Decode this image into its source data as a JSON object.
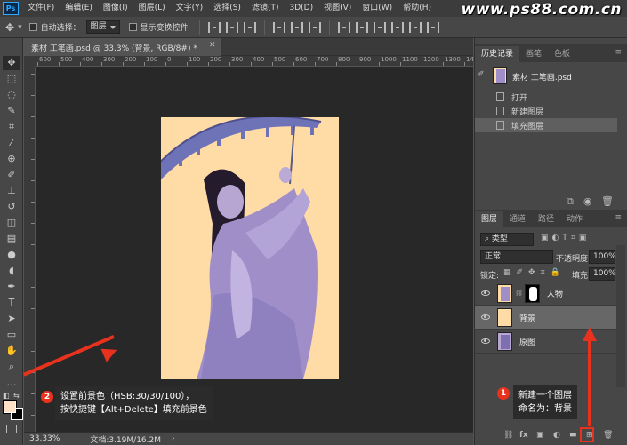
{
  "menubar": {
    "logo": "Ps",
    "items": [
      "文件(F)",
      "编辑(E)",
      "图像(I)",
      "图层(L)",
      "文字(Y)",
      "选择(S)",
      "滤镜(T)",
      "3D(D)",
      "视图(V)",
      "窗口(W)",
      "帮助(H)"
    ],
    "watermark": "www.ps88.com.cn"
  },
  "options": {
    "auto_select_label": "自动选择：",
    "auto_select_value": "图层",
    "show_transform_label": "显示变换控件"
  },
  "document": {
    "tab_title": "素材 工笔画.psd @ 33.3% (背景, RGB/8#) *",
    "ruler_ticks": [
      "600",
      "500",
      "400",
      "300",
      "200",
      "100",
      "0",
      "100",
      "200",
      "300",
      "400",
      "500",
      "600",
      "700",
      "800",
      "900",
      "1000",
      "1100",
      "1200",
      "1300",
      "1400"
    ],
    "zoom": "33.33%",
    "doc_size": "文档:3.19M/16.2M"
  },
  "history": {
    "tabs": [
      "历史记录",
      "画笔",
      "色板"
    ],
    "snapshot": "素材 工笔画.psd",
    "items": [
      "打开",
      "新建图层",
      "填充图层"
    ]
  },
  "layers": {
    "tabs": [
      "图层",
      "通道",
      "路径",
      "动作"
    ],
    "filter": "类型",
    "blend_mode": "正常",
    "opacity_label": "不透明度:",
    "opacity": "100%",
    "lock_label": "锁定:",
    "fill_label": "填充:",
    "fill": "100%",
    "rows": [
      "人物",
      "背景",
      "原图"
    ],
    "footer_icons": [
      "link-icon",
      "fx-icon",
      "mask-icon",
      "adjustment-icon",
      "folder-icon",
      "new-layer-icon",
      "trash-icon"
    ]
  },
  "annotations": {
    "callout_left_badge": "2",
    "callout_left_line1": "设置前景色（HSB:30/30/100），",
    "callout_left_line2": "按快捷键【Alt+Delete】填充前景色",
    "callout_right_badge": "1",
    "callout_right_line1": "新建一个图层",
    "callout_right_line2": "命名为：背景"
  },
  "colors": {
    "foreground": "#ffe1c6",
    "canvas_fill": "#ffdba6",
    "accent_red": "#e8321e"
  }
}
